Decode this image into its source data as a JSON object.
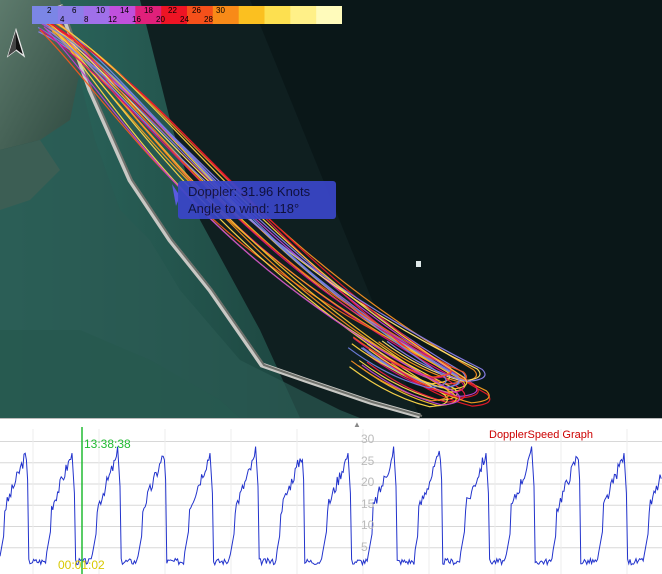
{
  "legend": {
    "top": [
      "2",
      "6",
      "10",
      "14",
      "18",
      "22",
      "26",
      "30"
    ],
    "bottom": [
      "4",
      "8",
      "12",
      "16",
      "20",
      "24",
      "28"
    ],
    "colors": [
      "#7b86e6",
      "#8b7ee8",
      "#a070ea",
      "#c050dc",
      "#e0207a",
      "#ee1424",
      "#f5501a",
      "#f88a18",
      "#fbc020",
      "#fde050",
      "#fff088",
      "#fffbbb"
    ]
  },
  "tooltip": {
    "line1": "Doppler: 31.96 Knots",
    "line2": "Angle to wind: 118°"
  },
  "graph": {
    "title": "DopplerSpeed Graph",
    "cursor_time": "13:38:38",
    "elapsed": "00:01:02",
    "y_ticks": [
      "30",
      "25",
      "20",
      "15",
      "10",
      "5"
    ],
    "line_color": "#2233cc"
  },
  "icons": {
    "north": "north-arrow-icon",
    "splitter": "splitter-handle-icon"
  }
}
